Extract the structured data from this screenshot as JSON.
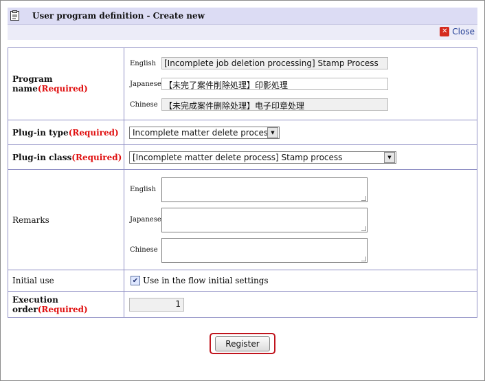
{
  "window": {
    "title": "User program definition - Create new",
    "close_label": "Close"
  },
  "form": {
    "program_name": {
      "label": "Program name",
      "required": "(Required)",
      "languages": [
        {
          "lang": "English",
          "value": "[Incomplete job deletion processing] Stamp Process"
        },
        {
          "lang": "Japanese",
          "value": "【未完了案件削除処理】印影処理"
        },
        {
          "lang": "Chinese",
          "value": "【未完成案件删除处理】电子印章处理"
        }
      ]
    },
    "plugin_type": {
      "label": "Plug-in type",
      "required": "(Required)",
      "selected": "Incomplete matter delete process"
    },
    "plugin_class": {
      "label": "Plug-in class",
      "required": "(Required)",
      "selected": "[Incomplete matter delete process] Stamp process"
    },
    "remarks": {
      "label": "Remarks",
      "languages": [
        {
          "lang": "English",
          "value": ""
        },
        {
          "lang": "Japanese",
          "value": ""
        },
        {
          "lang": "Chinese",
          "value": ""
        }
      ]
    },
    "initial_use": {
      "label": "Initial use",
      "checkbox_label": "Use in the flow initial settings",
      "checked": true
    },
    "execution_order": {
      "label": "Execution order",
      "required": "(Required)",
      "value": "1"
    }
  },
  "actions": {
    "register_label": "Register"
  }
}
